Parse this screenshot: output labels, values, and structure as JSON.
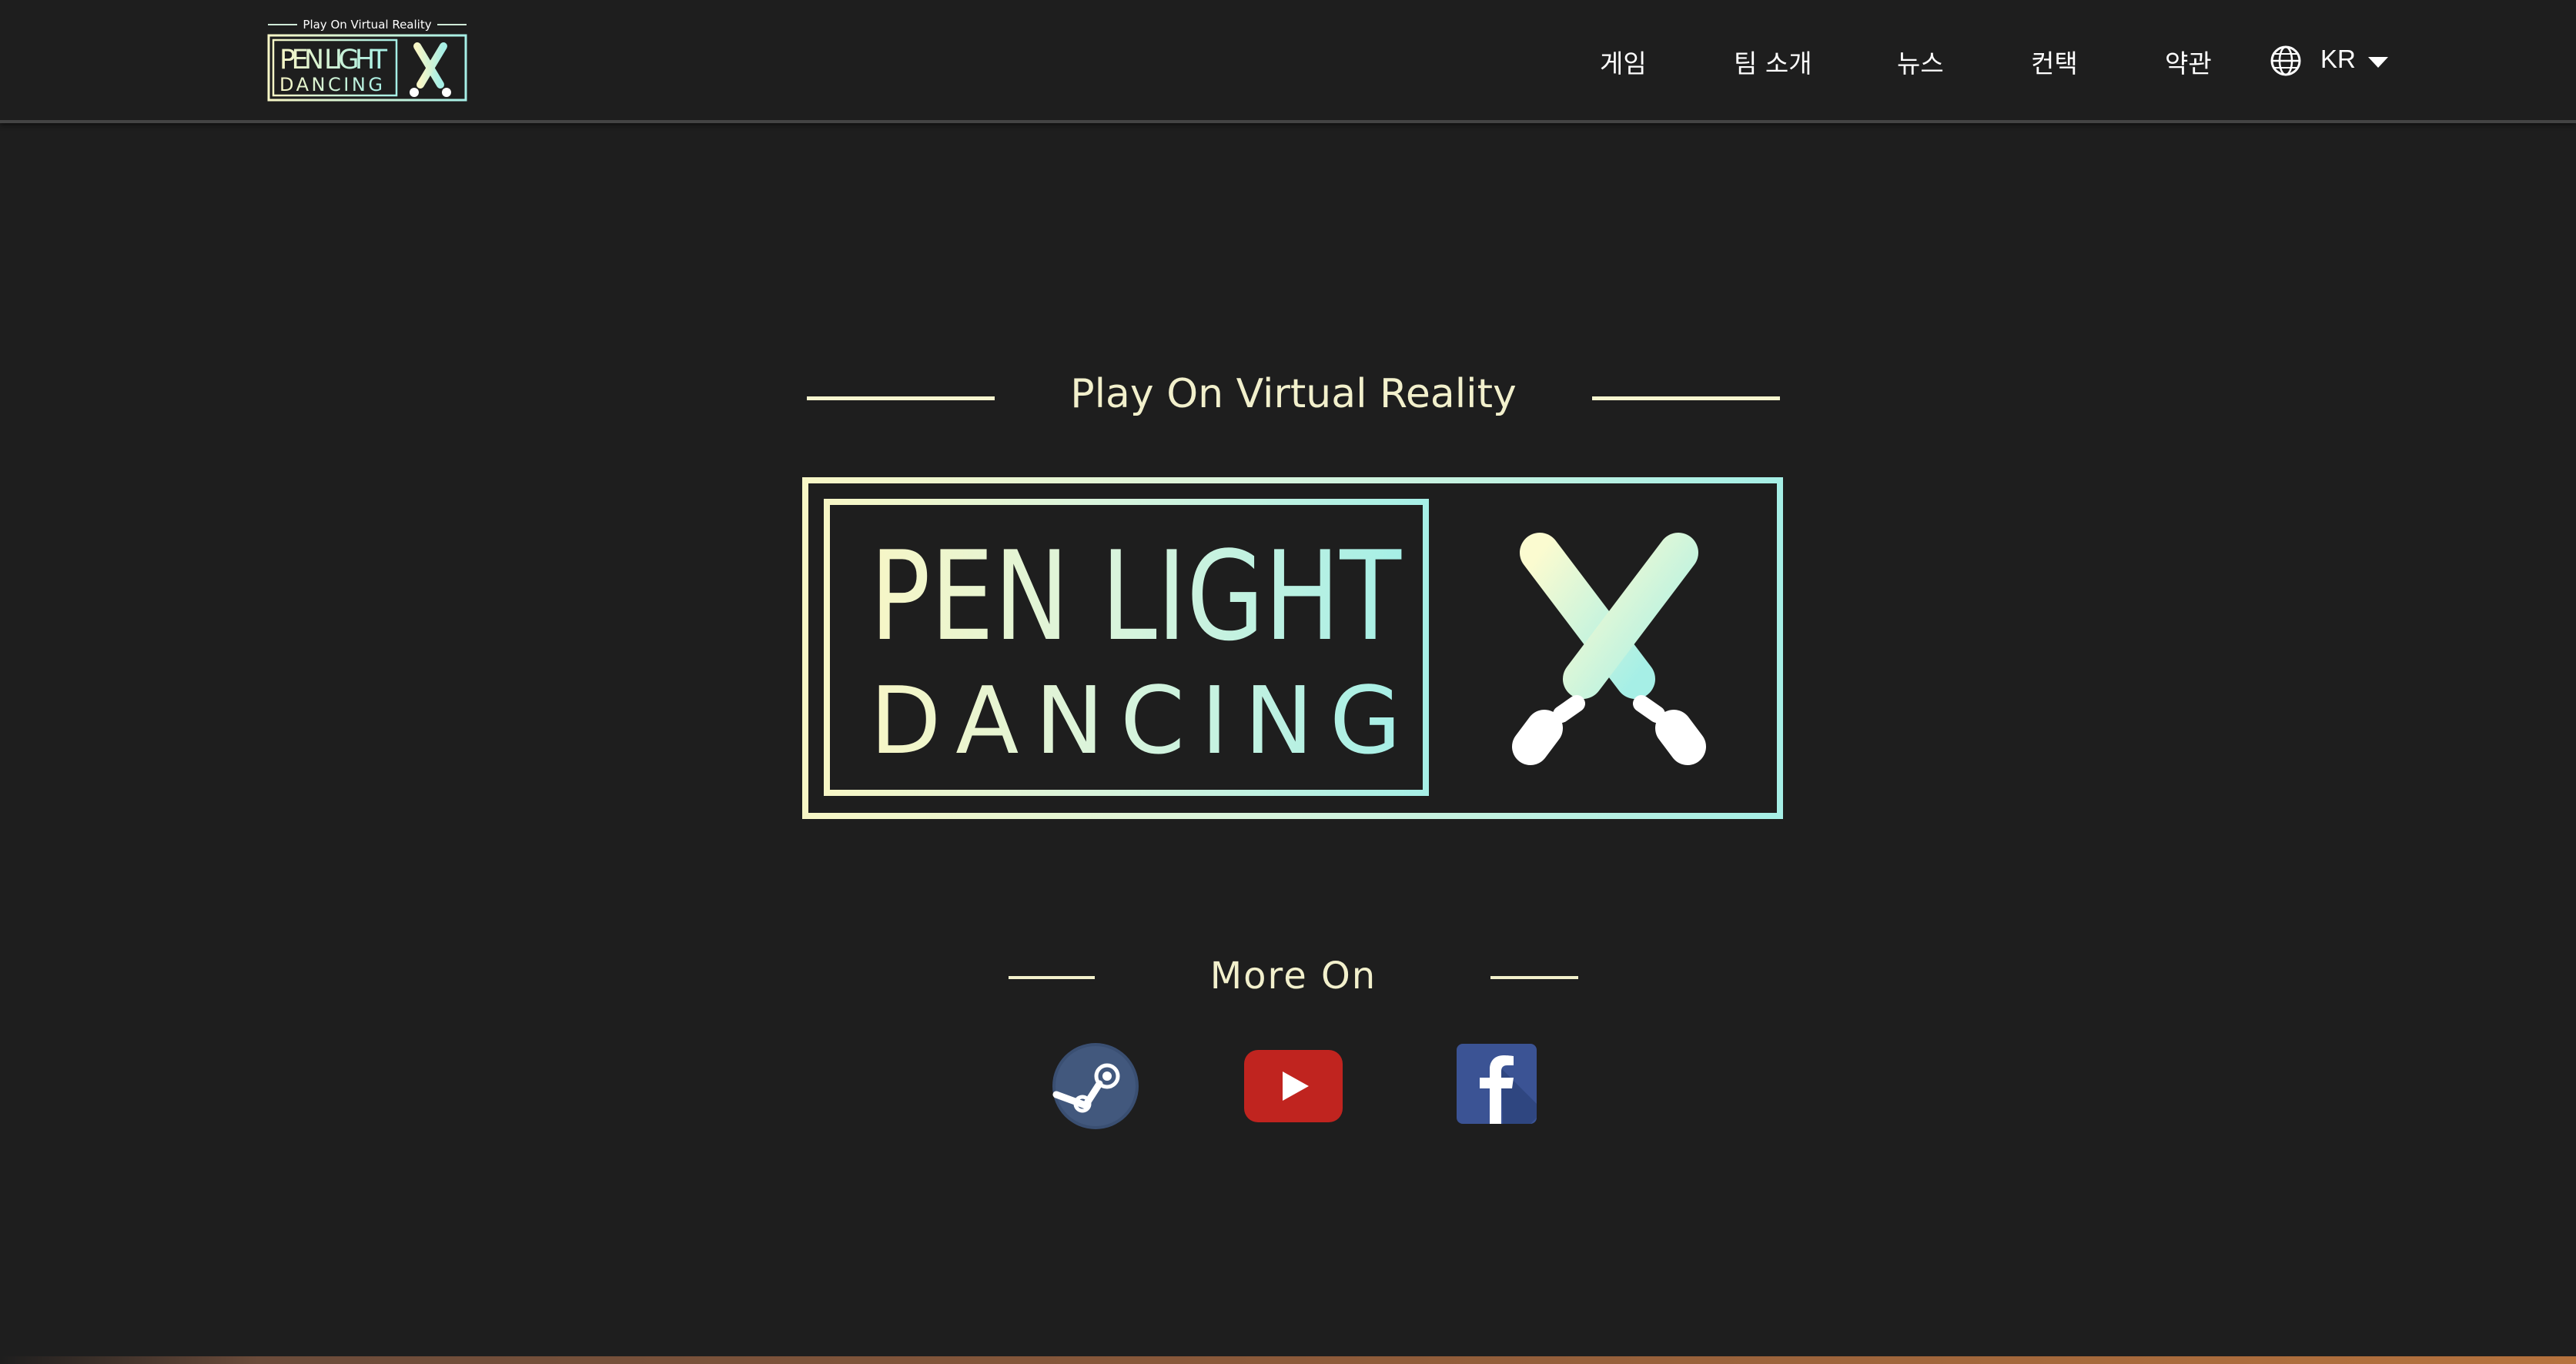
{
  "header": {
    "logo": {
      "tagline": "Play On Virtual Reality",
      "line1": "PEN LIGHT",
      "line2": "DANCING"
    },
    "nav": [
      {
        "label": "게임"
      },
      {
        "label": "팀 소개"
      },
      {
        "label": "뉴스"
      },
      {
        "label": "컨택"
      },
      {
        "label": "약관"
      }
    ],
    "language": {
      "icon": "globe-icon",
      "selected": "KR",
      "caret": "caret-down-icon"
    }
  },
  "hero": {
    "tagline": "Play On Virtual Reality",
    "logo": {
      "line1": "PEN LIGHT",
      "line2": "DANCING",
      "icon": "crossed-penlights-icon"
    },
    "gradient": {
      "start": "#f7f6c6",
      "end": "#a6efe6"
    }
  },
  "more": {
    "title": "More On",
    "links": [
      {
        "name": "Steam",
        "icon": "steam-icon",
        "color": "#3a4f72"
      },
      {
        "name": "YouTube",
        "icon": "youtube-icon",
        "color": "#c0241f"
      },
      {
        "name": "Facebook",
        "icon": "facebook-icon",
        "color": "#3b5394"
      }
    ]
  },
  "colors": {
    "background": "#1e1e1e",
    "accent": "#f2f0cc",
    "text": "#ffffff"
  }
}
